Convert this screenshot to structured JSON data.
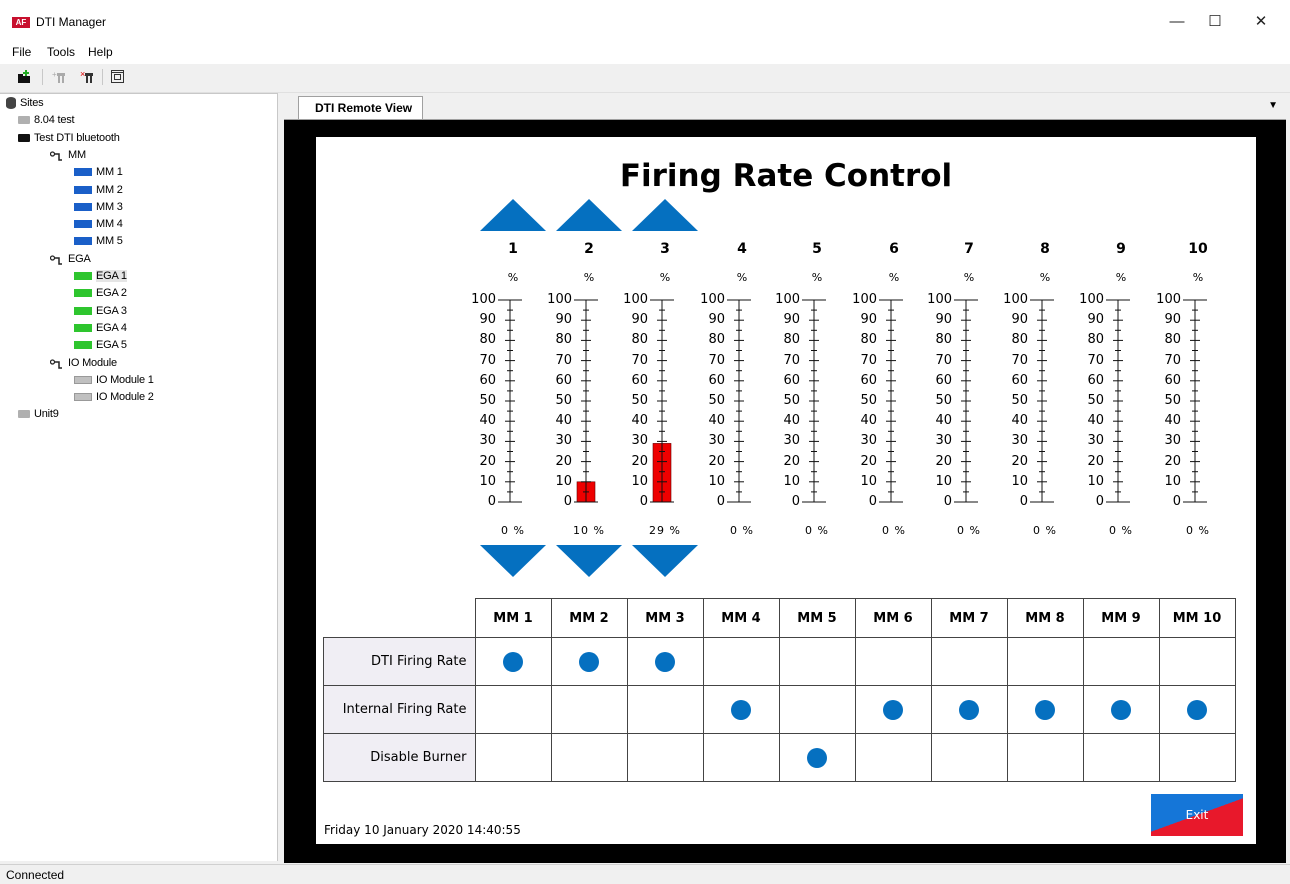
{
  "window": {
    "title": "DTI Manager",
    "logo_text": "AF",
    "minimize": "—",
    "maximize": "☐",
    "close": "✕"
  },
  "menu": [
    "File",
    "Tools",
    "Help"
  ],
  "tree": [
    {
      "label": "Sites",
      "icon": "database-icon",
      "level": 0
    },
    {
      "label": "8.04 test",
      "icon": "folder-icon-grey",
      "level": 1
    },
    {
      "label": "Test DTI bluetooth",
      "icon": "folder-icon-black",
      "level": 1
    },
    {
      "label": "MM",
      "icon": "network-icon",
      "level": 2
    },
    {
      "label": "MM 1",
      "icon": "blue",
      "level": 3
    },
    {
      "label": "MM 2",
      "icon": "blue",
      "level": 3
    },
    {
      "label": "MM 3",
      "icon": "blue",
      "level": 3
    },
    {
      "label": "MM 4",
      "icon": "blue",
      "level": 3
    },
    {
      "label": "MM 5",
      "icon": "blue",
      "level": 3
    },
    {
      "label": "EGA",
      "icon": "network-icon",
      "level": 2
    },
    {
      "label": "EGA 1",
      "icon": "green",
      "level": 3,
      "selected": true
    },
    {
      "label": "EGA 2",
      "icon": "green",
      "level": 3
    },
    {
      "label": "EGA 3",
      "icon": "green",
      "level": 3
    },
    {
      "label": "EGA 4",
      "icon": "green",
      "level": 3
    },
    {
      "label": "EGA 5",
      "icon": "green",
      "level": 3
    },
    {
      "label": "IO Module",
      "icon": "network-icon",
      "level": 2
    },
    {
      "label": "IO Module 1",
      "icon": "grey",
      "level": 3
    },
    {
      "label": "IO Module 2",
      "icon": "grey",
      "level": 3
    },
    {
      "label": "Unit9",
      "icon": "folder-icon-grey",
      "level": 1
    }
  ],
  "tab": {
    "label": "DTI Remote View",
    "menu_icon": "▼"
  },
  "panel": {
    "title": "Firing Rate Control",
    "pct_symbol": "%",
    "gauge_ticks": [
      "100",
      "90",
      "80",
      "70",
      "60",
      "50",
      "40",
      "30",
      "20",
      "10",
      "0"
    ],
    "channels": [
      {
        "num": "1",
        "value": 0,
        "readout": "0 %",
        "has_controls": true
      },
      {
        "num": "2",
        "value": 10,
        "readout": "10 %",
        "has_controls": true
      },
      {
        "num": "3",
        "value": 29,
        "readout": "29 %",
        "has_controls": true
      },
      {
        "num": "4",
        "value": 0,
        "readout": "0 %",
        "has_controls": false
      },
      {
        "num": "5",
        "value": 0,
        "readout": "0 %",
        "has_controls": false
      },
      {
        "num": "6",
        "value": 0,
        "readout": "0 %",
        "has_controls": false
      },
      {
        "num": "7",
        "value": 0,
        "readout": "0 %",
        "has_controls": false
      },
      {
        "num": "8",
        "value": 0,
        "readout": "0 %",
        "has_controls": false
      },
      {
        "num": "9",
        "value": 0,
        "readout": "0 %",
        "has_controls": false
      },
      {
        "num": "10",
        "value": 0,
        "readout": "0 %",
        "has_controls": false
      }
    ],
    "grid": {
      "columns": [
        "MM 1",
        "MM 2",
        "MM 3",
        "MM 4",
        "MM 5",
        "MM 6",
        "MM 7",
        "MM 8",
        "MM 9",
        "MM 10"
      ],
      "rows": [
        {
          "label": "DTI Firing Rate",
          "active": [
            0,
            1,
            2
          ]
        },
        {
          "label": "Internal Firing Rate",
          "active": [
            3,
            5,
            6,
            7,
            8,
            9
          ]
        },
        {
          "label": "Disable Burner",
          "active": [
            4
          ]
        }
      ]
    },
    "datetime": "Friday 10 January 2020 14:40:55",
    "exit_label": "Exit"
  },
  "status": "Connected",
  "colors": {
    "accent": "#0570c0",
    "bar_fill": "#ee0000",
    "blue_item": "#1a5fc8",
    "green_item": "#2ec52e",
    "grey_item": "#c0c0c0"
  }
}
